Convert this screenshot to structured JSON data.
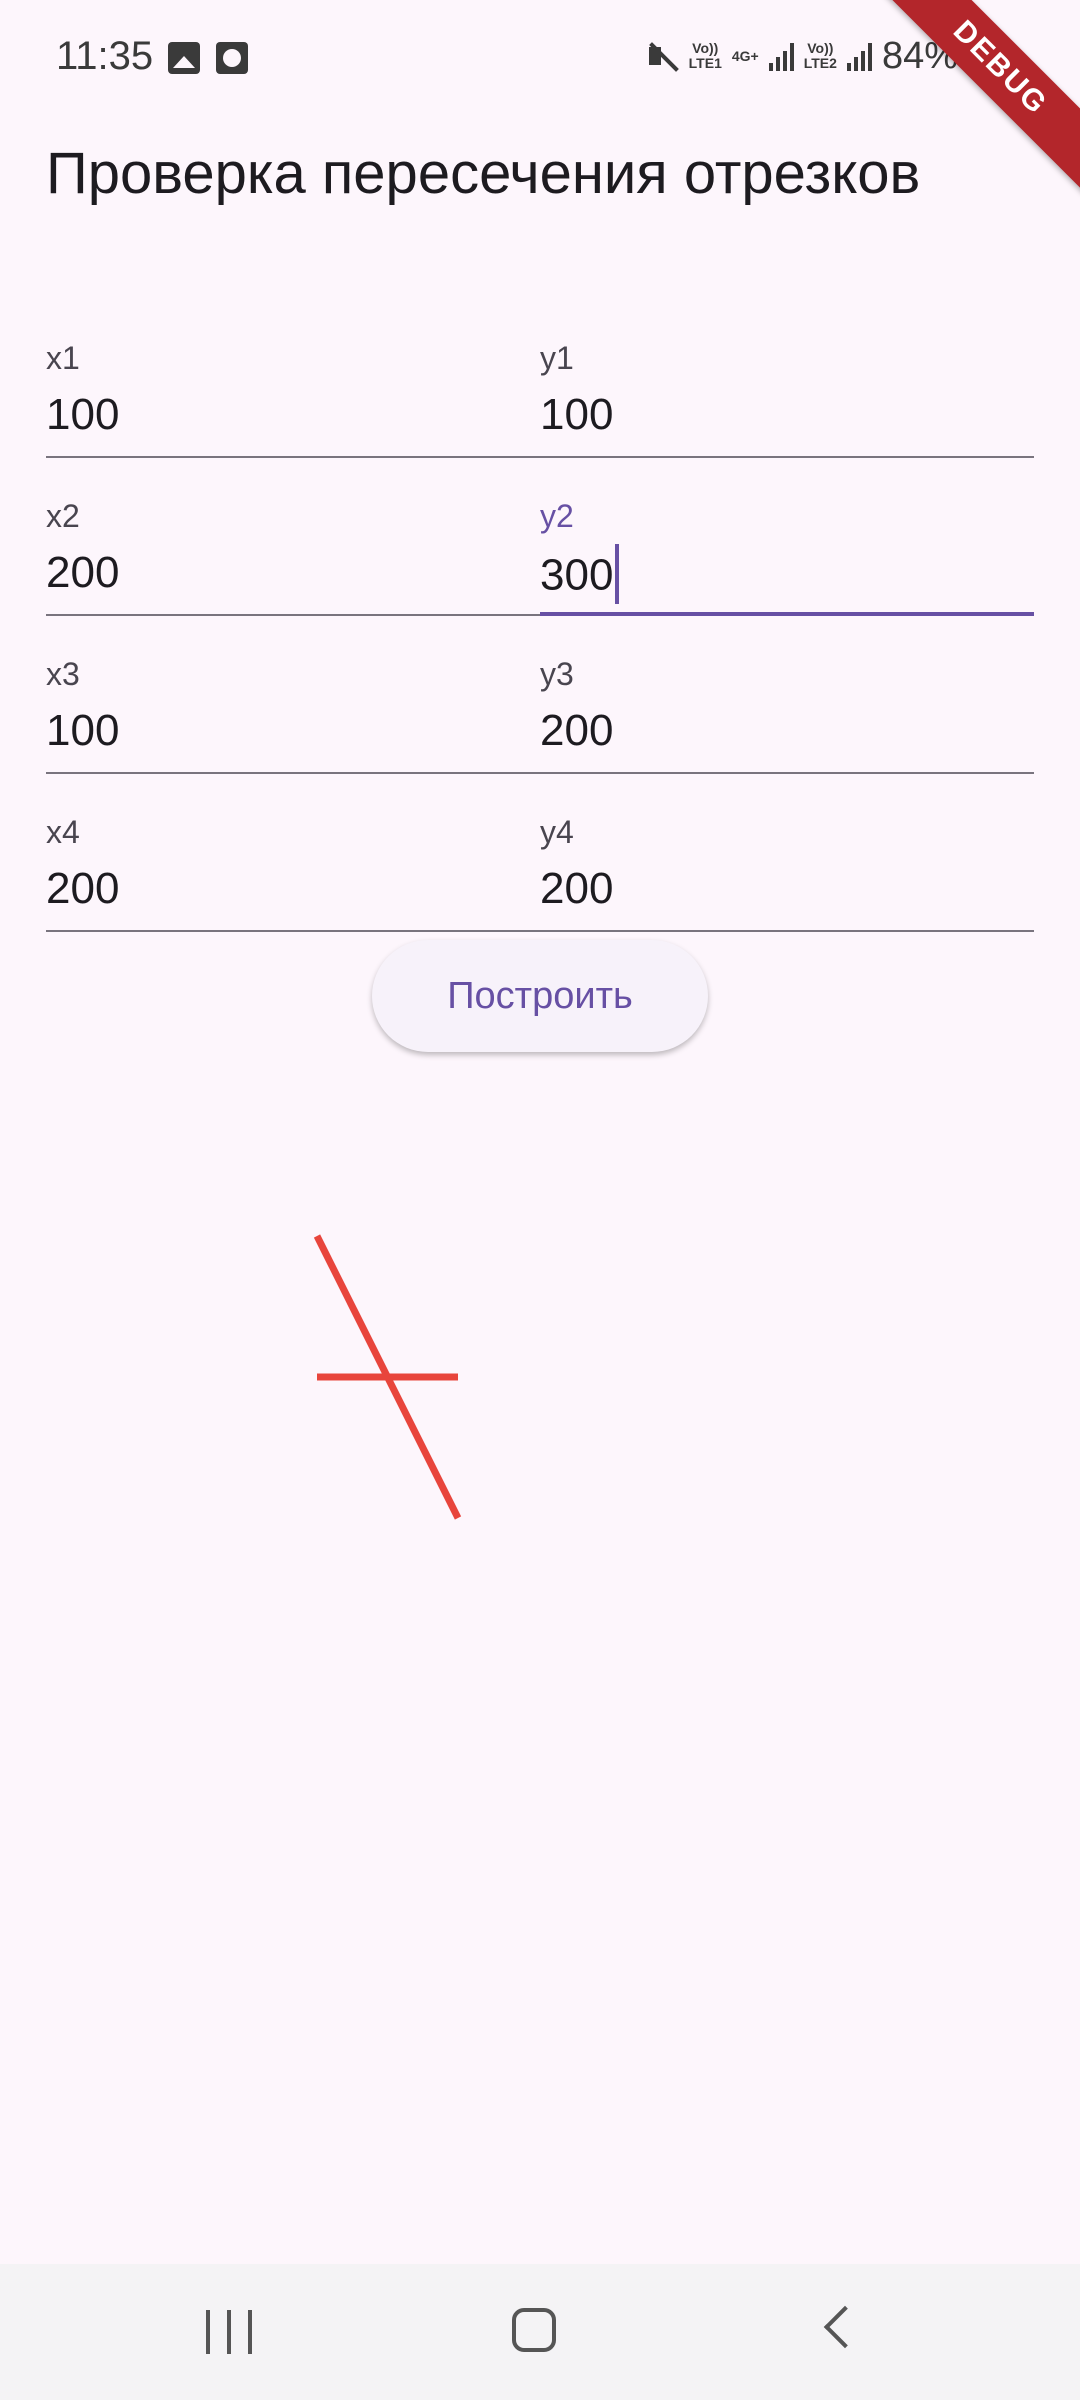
{
  "status_bar": {
    "time": "11:35",
    "volte1": "Vo))\nLTE1",
    "network": "4G+",
    "volte2": "Vo))\nLTE2",
    "battery": "84%",
    "debug_banner": "DEBUG"
  },
  "title": "Проверка пересечения отрезков",
  "fields": {
    "x1": {
      "label": "x1",
      "value": "100"
    },
    "y1": {
      "label": "y1",
      "value": "100"
    },
    "x2": {
      "label": "x2",
      "value": "200"
    },
    "y2": {
      "label": "y2",
      "value": "300"
    },
    "x3": {
      "label": "x3",
      "value": "100"
    },
    "y3": {
      "label": "y3",
      "value": "200"
    },
    "x4": {
      "label": "x4",
      "value": "200"
    },
    "y4": {
      "label": "y4",
      "value": "200"
    }
  },
  "build_button": "Построить",
  "segment_color": "#e8453c",
  "accent_color": "#6750a4"
}
